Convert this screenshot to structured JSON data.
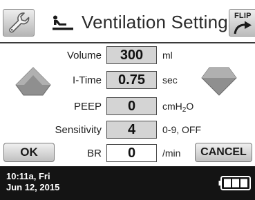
{
  "header": {
    "wrench_icon": "wrench-icon",
    "lung_icon": "lungs-icon",
    "title": "Ventilation Settings",
    "flip_label": "FLIP",
    "flip_icon": "curved-arrow-icon"
  },
  "settings": [
    {
      "label": "Volume",
      "value": "300",
      "unit": "ml",
      "highlight": true
    },
    {
      "label": "I-Time",
      "value": "0.75",
      "unit": "sec",
      "highlight": true
    },
    {
      "label": "PEEP",
      "value": "0",
      "unit_main": "cmH",
      "unit_sub": "2",
      "unit_tail": "O",
      "highlight": true
    },
    {
      "label": "Sensitivity",
      "value": "4",
      "unit": "0-9, OFF",
      "highlight": true
    },
    {
      "label": "BR",
      "value": "0",
      "unit": "/min",
      "highlight": false
    }
  ],
  "buttons": {
    "ok": "OK",
    "cancel": "CANCEL",
    "increase_icon": "up-arrow-icon",
    "decrease_icon": "down-arrow-icon"
  },
  "status": {
    "time": "10:11a, Fri",
    "date": "Jun 12, 2015",
    "battery_icon": "battery-icon",
    "battery_bars": 3
  },
  "colors": {
    "status_bar_bg": "#141414",
    "value_box_bg": "#d4d4d4",
    "arrow_fill": "#8f8f8f"
  }
}
